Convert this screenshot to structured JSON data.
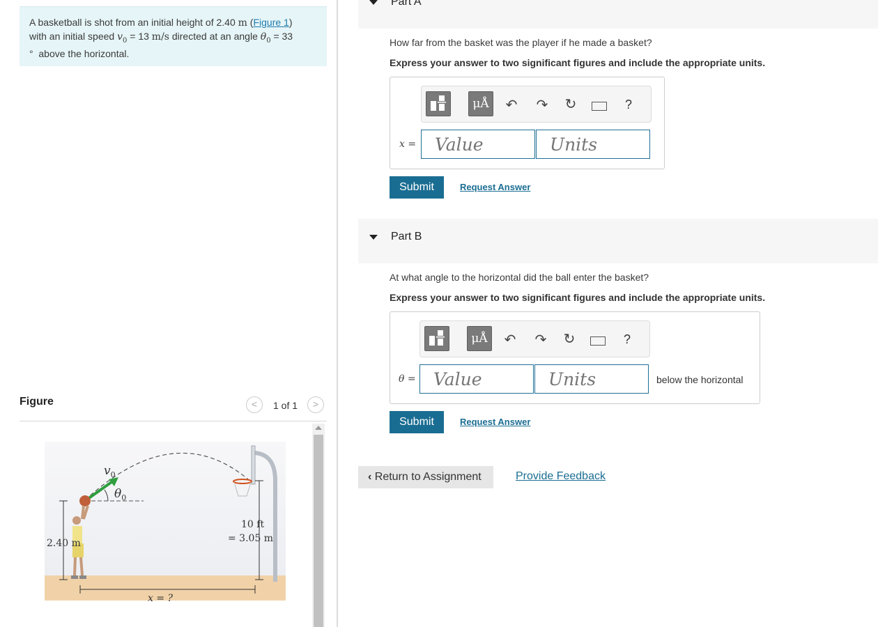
{
  "problem": {
    "intro": "A basketball is shot from an initial height of 2.40",
    "unit_m": "m",
    "fig_link": "Figure 1",
    "mid": "with an initial speed",
    "v0": "v",
    "v0_sub": "0",
    "eq_speed": "= 13",
    "speed_unit": "m/s",
    "mid2": "directed at an angle",
    "theta0": "θ",
    "theta0_sub": "0",
    "eq_angle": "= 33",
    "deg": "°",
    "end": "above the horizontal."
  },
  "figure": {
    "title": "Figure",
    "pager": "1 of 1",
    "prev": "<",
    "next": ">",
    "labels": {
      "v0": "v",
      "theta0": "θ",
      "sub0": "0",
      "height": "2.40 m",
      "hoop_ft": "10 ft",
      "hoop_m": "= 3.05 m",
      "x": "x = ?"
    }
  },
  "partA": {
    "title": "Part A",
    "question": "How far from the basket was the player if he made a basket?",
    "instruction": "Express your answer to two significant figures and include the appropriate units.",
    "var_label": "x =",
    "value_placeholder": "Value",
    "units_placeholder": "Units",
    "submit": "Submit",
    "request": "Request Answer",
    "tb_unit": "μÅ",
    "tb_help": "?"
  },
  "partB": {
    "title": "Part B",
    "question": "At what angle to the horizontal did the ball enter the basket?",
    "instruction": "Express your answer to two significant figures and include the appropriate units.",
    "var_label": "θ =",
    "value_placeholder": "Value",
    "units_placeholder": "Units",
    "suffix": "below the horizontal",
    "submit": "Submit",
    "request": "Request Answer",
    "tb_unit": "μÅ",
    "tb_help": "?"
  },
  "footer": {
    "return": "Return to Assignment",
    "feedback": "Provide Feedback"
  },
  "colors": {
    "accent": "#1a6d92",
    "problem_bg": "#e6f5f7",
    "arrow_green": "#2e9e3e"
  }
}
